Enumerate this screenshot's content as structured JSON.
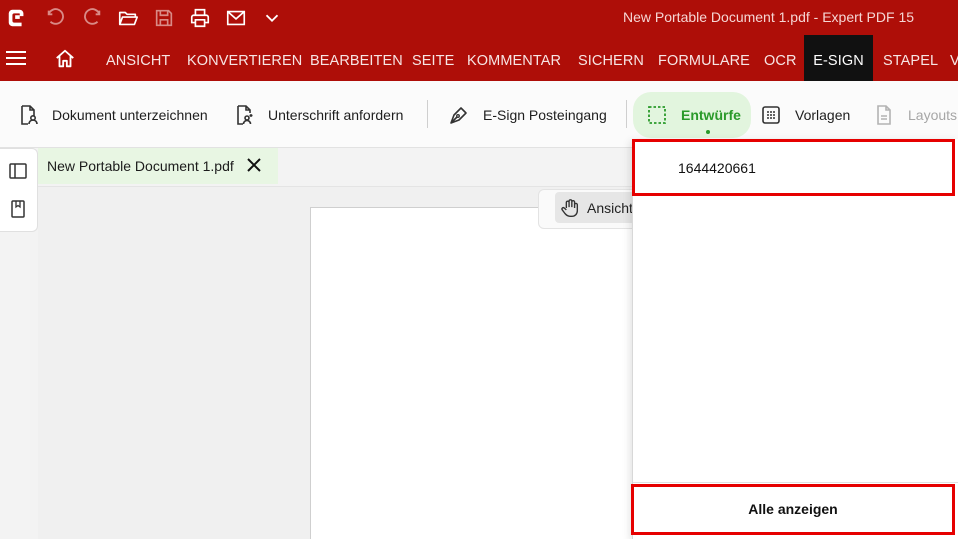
{
  "window": {
    "title": "New Portable Document 1.pdf   -   Expert PDF 15"
  },
  "quick_access": [
    "app-logo-icon",
    "undo-icon",
    "redo-icon",
    "open-folder-icon",
    "save-icon",
    "print-icon",
    "mail-icon",
    "chevron-down-icon"
  ],
  "menu": {
    "tabs": [
      {
        "label": "ANSICHT"
      },
      {
        "label": "KONVERTIEREN"
      },
      {
        "label": "BEARBEITEN"
      },
      {
        "label": "SEITE"
      },
      {
        "label": "KOMMENTAR"
      },
      {
        "label": "SICHERN"
      },
      {
        "label": "FORMULARE"
      },
      {
        "label": "OCR"
      },
      {
        "label": "E-SIGN"
      },
      {
        "label": "STAPEL"
      },
      {
        "label": "V"
      }
    ],
    "active": "E-SIGN"
  },
  "ribbon": {
    "sign_document": "Dokument unterzeichnen",
    "request_signature": "Unterschrift anfordern",
    "inbox": "E-Sign Posteingang",
    "drafts": "Entwürfe",
    "templates": "Vorlagen",
    "layouts": "Layouts"
  },
  "document_tab": {
    "name": "New Portable Document 1.pdf"
  },
  "view_tool": {
    "label": "Ansicht"
  },
  "drafts_dropdown": {
    "items": [
      {
        "label": "1644420661"
      }
    ],
    "footer": "Alle anzeigen"
  },
  "colors": {
    "brand_red": "#ae0e08",
    "active_tab": "#111111",
    "drafts_green": "#2a9a2a",
    "highlight_border": "#e60000"
  }
}
